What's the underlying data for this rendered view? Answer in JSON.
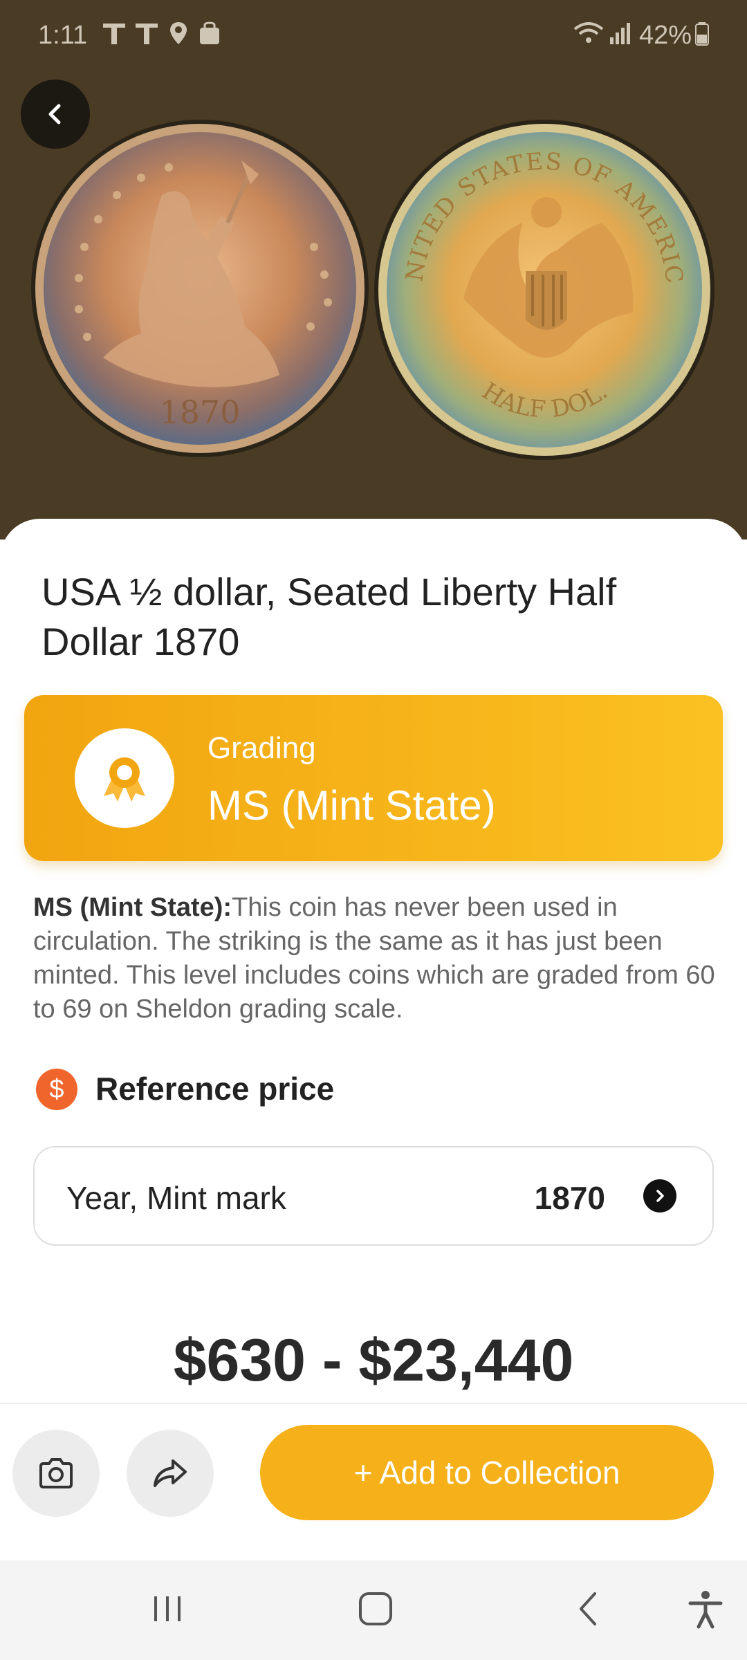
{
  "status": {
    "time": "1:11",
    "battery": "42%"
  },
  "title": "USA ½ dollar, Seated Liberty Half Dollar 1870",
  "coin": {
    "obverse_year": "1870",
    "reverse_top": "UNITED STATES OF AMERICA",
    "reverse_bottom": "HALF DOL."
  },
  "grading": {
    "label": "Grading",
    "value": "MS (Mint State)"
  },
  "description": {
    "bold": "MS (Mint State):",
    "text": "This coin has never been used in circulation. The striking is the same as it has just been minted. This level includes coins which are graded from 60 to 69 on Sheldon grading scale."
  },
  "reference": {
    "icon_symbol": "$",
    "title": "Reference price",
    "selector_label": "Year, Mint mark",
    "selector_value": "1870"
  },
  "price": "$630 - $23,440",
  "actions": {
    "add_label": "+ Add to Collection"
  },
  "colors": {
    "accent": "#f6b019",
    "hero_bg": "#4a3b24",
    "ref_icon": "#f0652b"
  },
  "icons": {
    "back": "chevron-left-icon",
    "camera": "camera-icon",
    "share": "share-icon",
    "badge": "award-ribbon-icon"
  }
}
